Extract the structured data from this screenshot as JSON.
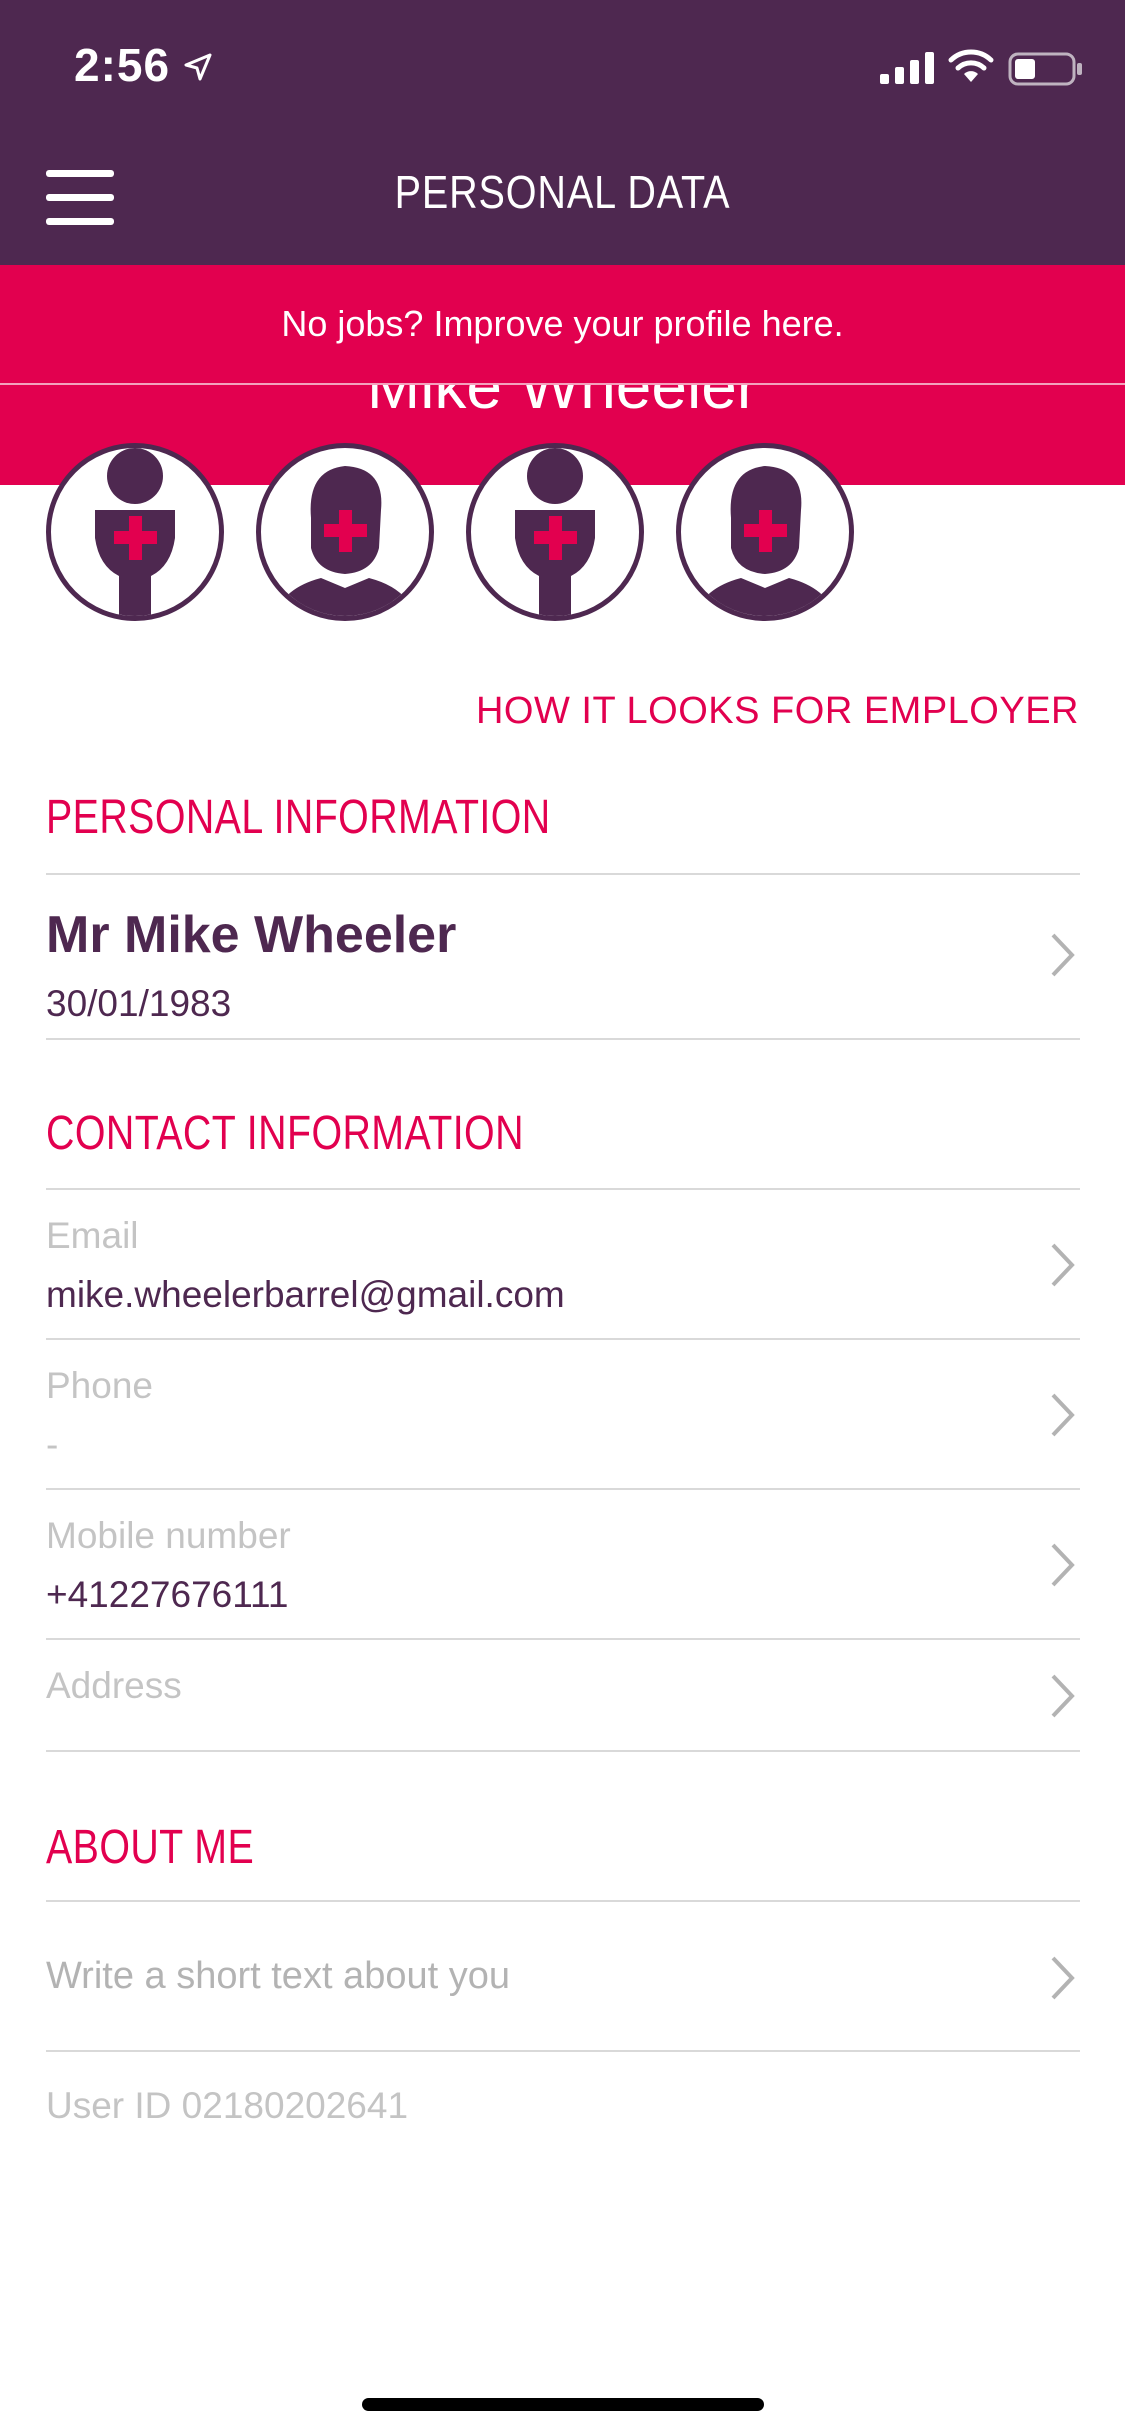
{
  "status_bar": {
    "time": "2:56"
  },
  "nav": {
    "title": "PERSONAL DATA",
    "menu_icon": "hamburger-menu-icon"
  },
  "banner": {
    "text": "No jobs? Improve your profile here.",
    "behind_name": "Mike Wheeler"
  },
  "avatars": [
    {
      "icon": "female-medic-avatar-icon"
    },
    {
      "icon": "male-medic-avatar-icon"
    },
    {
      "icon": "female-medic-avatar-icon"
    },
    {
      "icon": "male-medic-avatar-icon"
    }
  ],
  "employer_link": "HOW IT LOOKS FOR EMPLOYER",
  "personal": {
    "title": "PERSONAL INFORMATION",
    "name": "Mr Mike Wheeler",
    "dob": "30/01/1983"
  },
  "contact": {
    "title": "CONTACT INFORMATION",
    "fields": [
      {
        "label": "Email",
        "value": "mike.wheelerbarrel@gmail.com"
      },
      {
        "label": "Phone",
        "value": "-"
      },
      {
        "label": "Mobile number",
        "value": "+41227676111"
      },
      {
        "label": "Address",
        "value": ""
      }
    ]
  },
  "about": {
    "title": "ABOUT ME",
    "placeholder": "Write a short text about you"
  },
  "user_id": "User ID 02180202641",
  "colors": {
    "primary": "#4e2850",
    "accent": "#e2004f",
    "divider": "#d9d9d9",
    "muted": "#c4c4c4"
  }
}
